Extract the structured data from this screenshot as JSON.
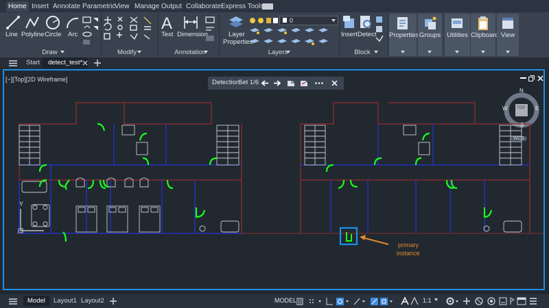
{
  "ribbon_tabs": [
    "Home",
    "Insert",
    "Annotate",
    "Parametric",
    "View",
    "Manage",
    "Output",
    "Collaborate",
    "Express Tools"
  ],
  "draw_panel": {
    "tools": [
      "Line",
      "Polyline",
      "Circle",
      "Arc"
    ],
    "label": "Draw"
  },
  "modify_panel": {
    "label": "Modify"
  },
  "annotation_panel": {
    "tools": [
      "Text",
      "Dimension"
    ],
    "label": "Annotation"
  },
  "layers_panel": {
    "tool": "Layer\nProperties",
    "tool_line1": "Layer",
    "tool_line2": "Properties",
    "current_layer": "0",
    "label": "Layers"
  },
  "block_panel": {
    "tools": [
      "Insert",
      "Detect"
    ],
    "label": "Block"
  },
  "right_panels": [
    "Properties",
    "Groups",
    "Utilities",
    "Clipboard",
    "View"
  ],
  "file_tabs": {
    "start": "Start",
    "active": "detect_test*"
  },
  "viewport": {
    "label": "[−][Top][2D Wireframe]",
    "detection": {
      "title": "Detection:",
      "set_text": "Set  1/6"
    },
    "viewcube": {
      "n": "N",
      "s": "S",
      "e": "E",
      "w": "W",
      "top": "TOP",
      "wcs": "WCS"
    },
    "axis_y": "Y",
    "annotation": {
      "line1": "primary",
      "line2": "instance",
      "color": "#e58a2e"
    },
    "highlight_color": "#1e8fe8",
    "door_color": "#18ff1c",
    "wall_color": "#2130c9",
    "frame_color": "#b03030"
  },
  "layout_tabs": [
    "Model",
    "Layout1",
    "Layout2"
  ],
  "status": {
    "model": "MODEL",
    "scale": "1:1"
  }
}
